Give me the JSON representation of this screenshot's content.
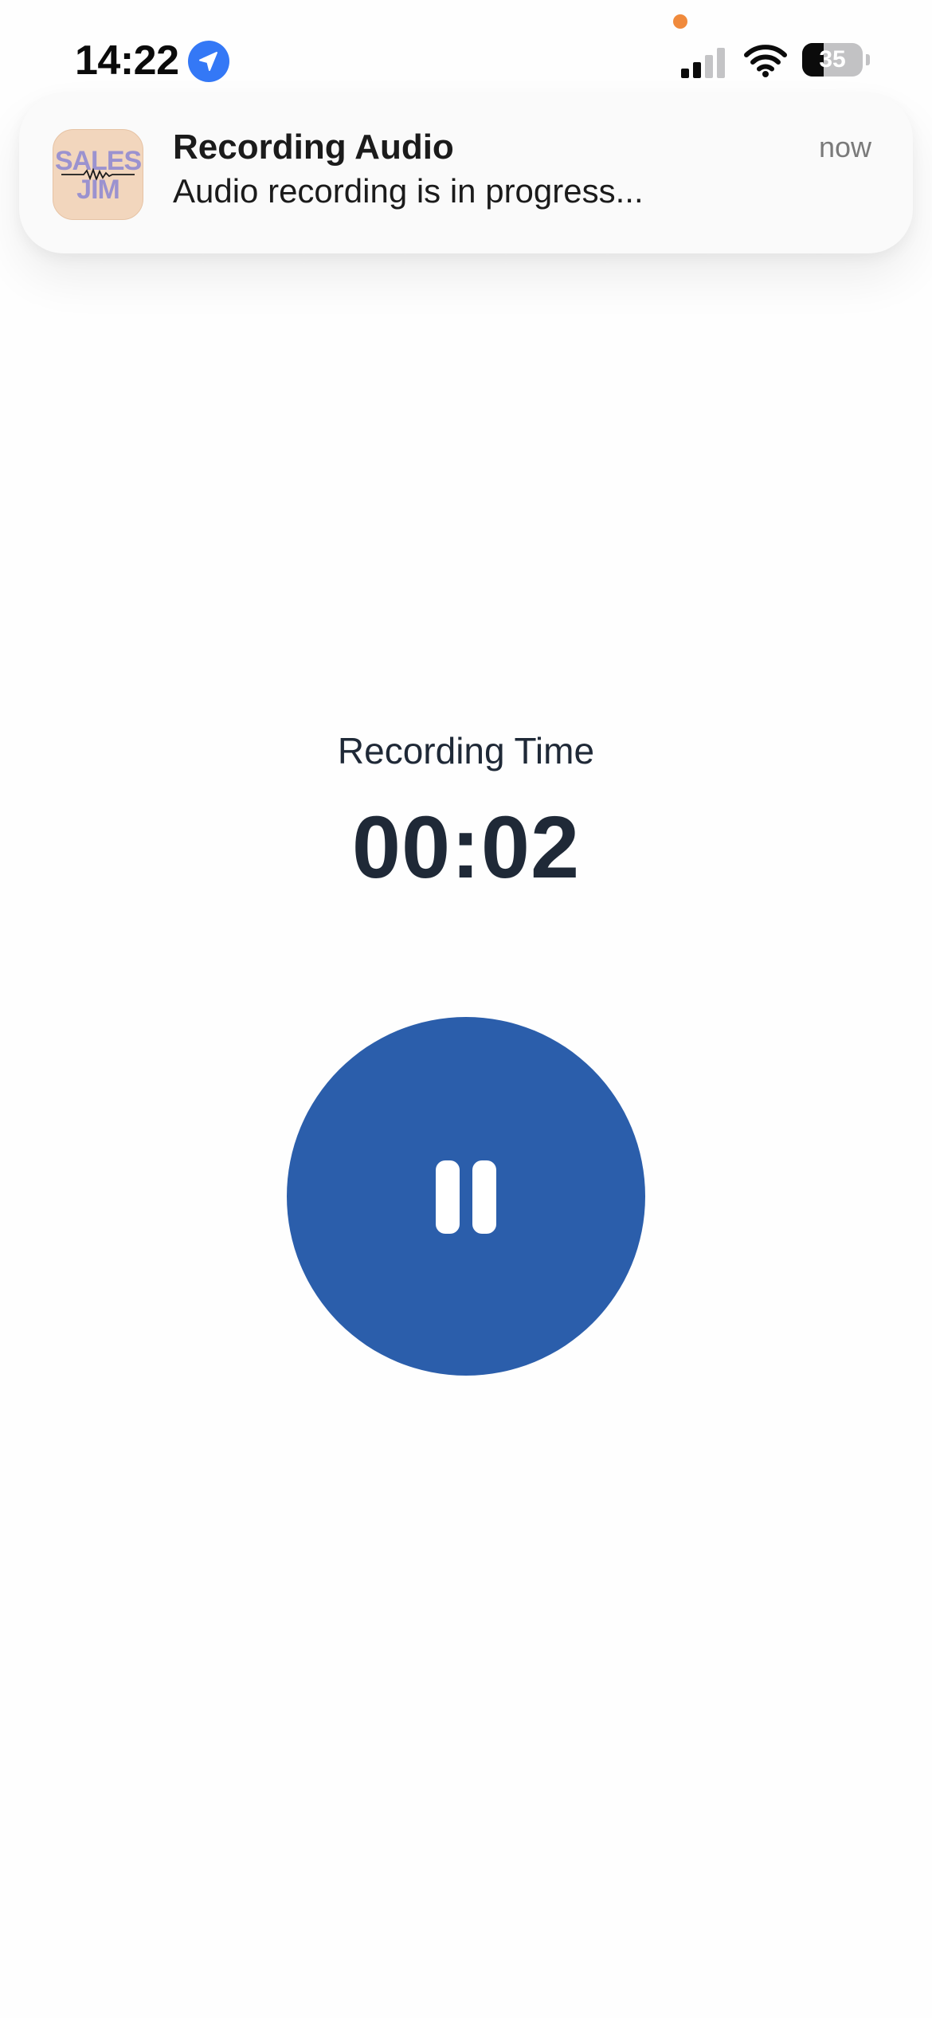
{
  "status_bar": {
    "time": "14:22",
    "battery_percent": "35",
    "battery_level": 0.35,
    "location_icon": "location-arrow-icon",
    "signal_icon": "cellular-signal-icon",
    "wifi_icon": "wifi-icon",
    "battery_icon": "battery-icon",
    "privacy_indicator_color": "#f08a3c"
  },
  "notification": {
    "app_icon": "sales-jim-app-icon",
    "app_icon_text_line1": "SALES",
    "app_icon_text_line2": "JIM",
    "title": "Recording Audio",
    "body": "Audio recording is in progress...",
    "time": "now"
  },
  "recorder": {
    "label": "Recording Time",
    "elapsed": "00:02",
    "pause_icon": "pause-icon",
    "button_color": "#2b5eab"
  }
}
